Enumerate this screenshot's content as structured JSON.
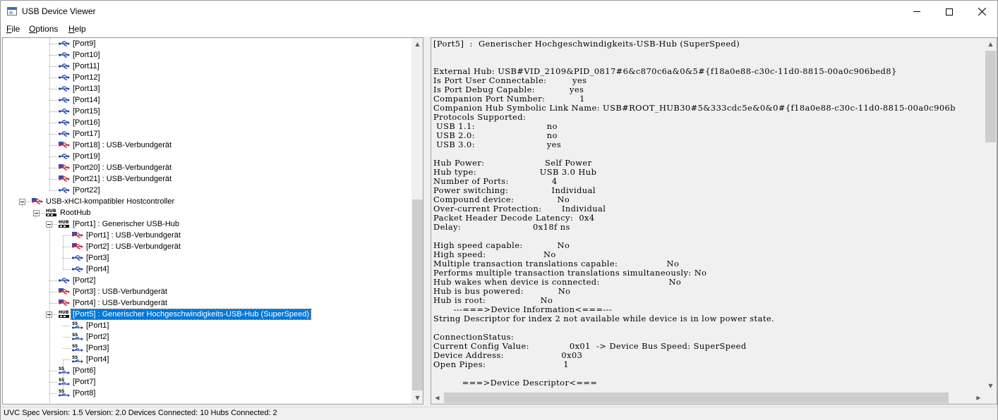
{
  "window": {
    "title": "USB Device Viewer"
  },
  "menu": {
    "items": [
      {
        "label": "File"
      },
      {
        "label": "Options"
      },
      {
        "label": "Help"
      }
    ]
  },
  "tree": {
    "rows": [
      {
        "label": "[Port9]",
        "icon": "usb-port-icon"
      },
      {
        "label": "[Port10]",
        "icon": "usb-port-icon"
      },
      {
        "label": "[Port11]",
        "icon": "usb-port-icon"
      },
      {
        "label": "[Port12]",
        "icon": "usb-port-icon"
      },
      {
        "label": "[Port13]",
        "icon": "usb-port-icon"
      },
      {
        "label": "[Port14]",
        "icon": "usb-port-icon"
      },
      {
        "label": "[Port15]",
        "icon": "usb-port-icon"
      },
      {
        "label": "[Port16]",
        "icon": "usb-port-icon"
      },
      {
        "label": "[Port17]",
        "icon": "usb-port-icon"
      },
      {
        "label": "[Port18]  :  USB-Verbundgerät",
        "icon": "usb-device-icon"
      },
      {
        "label": "[Port19]",
        "icon": "usb-port-icon"
      },
      {
        "label": "[Port20]  :  USB-Verbundgerät",
        "icon": "usb-device-icon"
      },
      {
        "label": "[Port21]  :  USB-Verbundgerät",
        "icon": "usb-device-icon"
      },
      {
        "label": "[Port22]",
        "icon": "usb-port-icon"
      },
      {
        "label": "USB-xHCI-kompatibler Hostcontroller",
        "icon": "usb-controller-icon"
      },
      {
        "label": "RootHub",
        "icon": "hub-icon",
        "icon_text": "HUB"
      },
      {
        "label": "[Port1]  :  Generischer USB-Hub",
        "icon": "hub-icon",
        "icon_text": "HUB"
      },
      {
        "label": "[Port1]  :  USB-Verbundgerät",
        "icon": "usb-device-icon"
      },
      {
        "label": "[Port2]  :  USB-Verbundgerät",
        "icon": "usb-device-icon"
      },
      {
        "label": "[Port3]",
        "icon": "usb-port-icon"
      },
      {
        "label": "[Port4]",
        "icon": "usb-port-icon"
      },
      {
        "label": "[Port2]",
        "icon": "usb-port-icon"
      },
      {
        "label": "[Port3]  :  USB-Verbundgerät",
        "icon": "usb-device-icon"
      },
      {
        "label": "[Port4]  :  USB-Verbundgerät",
        "icon": "usb-device-icon"
      },
      {
        "label": "[Port5]  :  Generischer Hochgeschwindigkeits-USB-Hub (SuperSpeed)",
        "icon": "hub-icon",
        "icon_text": "HUB"
      },
      {
        "label": "[Port1]",
        "icon": "superspeed-port-icon",
        "icon_text": "SS"
      },
      {
        "label": "[Port2]",
        "icon": "superspeed-port-icon",
        "icon_text": "SS"
      },
      {
        "label": "[Port3]",
        "icon": "superspeed-port-icon",
        "icon_text": "SS"
      },
      {
        "label": "[Port4]",
        "icon": "superspeed-port-icon",
        "icon_text": "SS"
      },
      {
        "label": "[Port6]",
        "icon": "superspeed-port-icon",
        "icon_text": "SS"
      },
      {
        "label": "[Port7]",
        "icon": "superspeed-port-icon",
        "icon_text": "SS"
      },
      {
        "label": "[Port8]",
        "icon": "superspeed-port-icon",
        "icon_text": "SS"
      }
    ],
    "selected_label": "[Port5]  :  Generischer Hochgeschwindigkeits-USB-Hub (SuperSpeed)"
  },
  "details": {
    "lines": [
      "[Port5]  :  Generischer Hochgeschwindigkeits-USB-Hub (SuperSpeed)",
      "",
      "",
      "External Hub: USB#VID_2109&PID_0817#6&c870c6a&0&5#{f18a0e88-c30c-11d0-8815-00a0c906bed8}",
      "Is Port User Connectable:         yes",
      "Is Port Debug Capable:            yes",
      "Companion Port Number:            1",
      "Companion Hub Symbolic Link Name: USB#ROOT_HUB30#5&333cdc5e&0&0#{f18a0e88-c30c-11d0-8815-00a0c906b",
      "Protocols Supported:",
      " USB 1.1:                         no",
      " USB 2.0:                         no",
      " USB 3.0:                         yes",
      "",
      "Hub Power:                     Self Power",
      "Hub type:                      USB 3.0 Hub",
      "Number of Ports:               4",
      "Power switching:               Individual",
      "Compound device:               No",
      "Over-current Protection:       Individual",
      "Packet Header Decode Latency:  0x4",
      "Delay:                         0x18f ns",
      "",
      "High speed capable:            No",
      "High speed:                    No",
      "Multiple transaction translations capable:                 No",
      "Performs multiple transaction translations simultaneously: No",
      "Hub wakes when device is connected:                        No",
      "Hub is bus powered:            No",
      "Hub is root:                   No",
      "       ---===>Device Information<===---",
      "String Descriptor for index 2 not available while device is in low power state.",
      "",
      "ConnectionStatus:",
      "Current Config Value:              0x01  -> Device Bus Speed: SuperSpeed",
      "Device Address:                    0x03",
      "Open Pipes:                           1",
      "",
      "          ===>Device Descriptor<==="
    ]
  },
  "status_bar": {
    "text": "UVC Spec Version: 1.5 Version: 2.0 Devices Connected: 10   Hubs Connected: 2"
  },
  "colors": {
    "selection": "#0078d7",
    "usb_icon": "#1b3fa8",
    "device_icon_red": "#c41e3a"
  }
}
